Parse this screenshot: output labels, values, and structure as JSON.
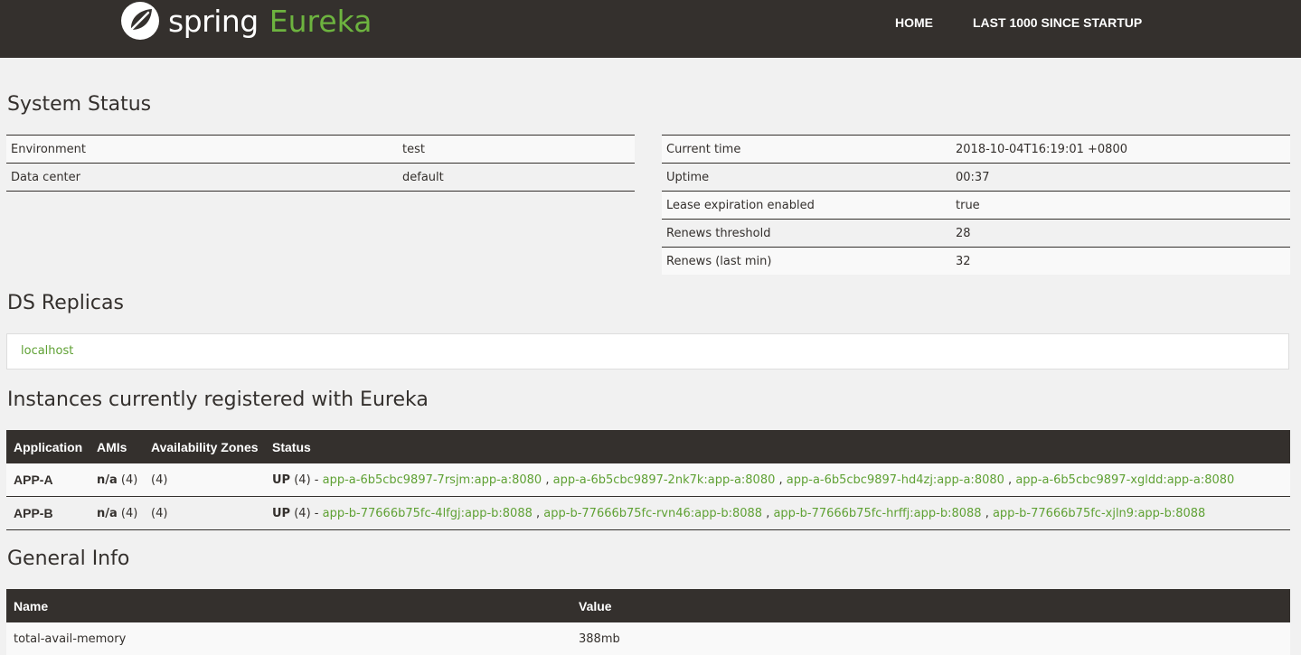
{
  "navbar": {
    "brand_spring": "spring",
    "brand_eureka": "Eureka",
    "home": "HOME",
    "last1000": "LAST 1000 SINCE STARTUP"
  },
  "colors": {
    "accent": "#6db33f",
    "dark": "#34302d",
    "background": "#f1f1f1"
  },
  "system_status": {
    "title": "System Status",
    "left": [
      {
        "label": "Environment",
        "value": "test"
      },
      {
        "label": "Data center",
        "value": "default"
      }
    ],
    "right": [
      {
        "label": "Current time",
        "value": "2018-10-04T16:19:01 +0800"
      },
      {
        "label": "Uptime",
        "value": "00:37"
      },
      {
        "label": "Lease expiration enabled",
        "value": "true"
      },
      {
        "label": "Renews threshold",
        "value": "28"
      },
      {
        "label": "Renews (last min)",
        "value": "32"
      }
    ]
  },
  "ds_replicas": {
    "title": "DS Replicas",
    "items": [
      "localhost"
    ]
  },
  "instances": {
    "title": "Instances currently registered with Eureka",
    "headers": [
      "Application",
      "AMIs",
      "Availability Zones",
      "Status"
    ],
    "rows": [
      {
        "app": "APP-A",
        "amis": "n/a",
        "amis_count": "(4)",
        "zones": "(4)",
        "status": "UP",
        "status_count": "(4) -",
        "instances": [
          "app-a-6b5cbc9897-7rsjm:app-a:8080",
          "app-a-6b5cbc9897-2nk7k:app-a:8080",
          "app-a-6b5cbc9897-hd4zj:app-a:8080",
          "app-a-6b5cbc9897-xgldd:app-a:8080"
        ]
      },
      {
        "app": "APP-B",
        "amis": "n/a",
        "amis_count": "(4)",
        "zones": "(4)",
        "status": "UP",
        "status_count": "(4) -",
        "instances": [
          "app-b-77666b75fc-4lfgj:app-b:8088",
          "app-b-77666b75fc-rvn46:app-b:8088",
          "app-b-77666b75fc-hrffj:app-b:8088",
          "app-b-77666b75fc-xjln9:app-b:8088"
        ]
      }
    ]
  },
  "general_info": {
    "title": "General Info",
    "headers": [
      "Name",
      "Value"
    ],
    "rows": [
      {
        "name": "total-avail-memory",
        "value": "388mb"
      }
    ]
  }
}
